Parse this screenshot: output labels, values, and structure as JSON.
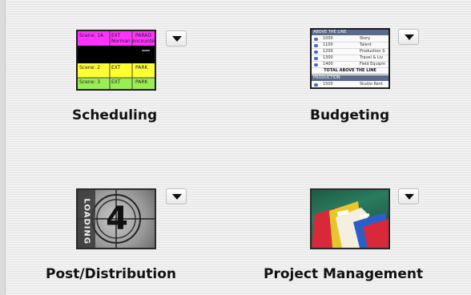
{
  "tiles": [
    {
      "id": "scheduling",
      "label": "Scheduling",
      "thumbnail": {
        "rows": [
          {
            "color": "#ff33ff",
            "scene": "Scene: 1A",
            "int_ext": "EXT",
            "location": "PARAD",
            "extra": "Norman encounters"
          },
          {
            "color": "#000000",
            "scene": "",
            "int_ext": "",
            "location": "",
            "extra": ""
          },
          {
            "color": "#ffff33",
            "scene": "Scene: 2",
            "int_ext": "EXT",
            "location": "PARK",
            "extra": ""
          },
          {
            "color": "#99ee55",
            "scene": "Scene: 3",
            "int_ext": "EXT",
            "location": "PARK",
            "extra": ""
          }
        ]
      }
    },
    {
      "id": "budgeting",
      "label": "Budgeting",
      "thumbnail": {
        "header_top": "ABOVE THE LINE",
        "rows": [
          {
            "num": "1000",
            "desc": "Story"
          },
          {
            "num": "1100",
            "desc": "Talent"
          },
          {
            "num": "1200",
            "desc": "Production S"
          },
          {
            "num": "1300",
            "desc": "Travel & Liv"
          },
          {
            "num": "1400",
            "desc": "Field Equipm"
          }
        ],
        "total": "TOTAL ABOVE THE LINE",
        "header_bottom": "PRODUCTION",
        "rows_bottom": [
          {
            "num": "1500",
            "desc": "Studio Rent"
          }
        ]
      }
    },
    {
      "id": "post-distribution",
      "label": "Post/Distribution",
      "thumbnail": {
        "loading_text": "LOADING",
        "countdown_number": "4"
      }
    },
    {
      "id": "project-management",
      "label": "Project Management",
      "thumbnail": {
        "folder_colors": [
          "#d8283a",
          "#e8c62a",
          "#2a5fc8",
          "#f4efe0"
        ]
      }
    }
  ]
}
